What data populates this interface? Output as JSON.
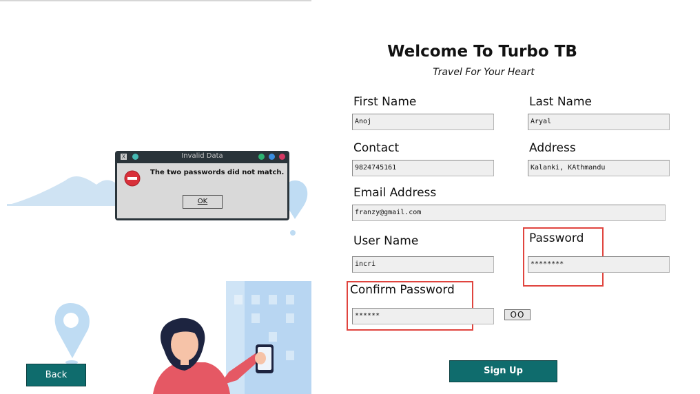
{
  "app": {
    "title": "Welcome To Turbo TB",
    "subtitle": "Travel For Your Heart"
  },
  "form": {
    "first_name": {
      "label": "First Name",
      "value": "Anoj"
    },
    "last_name": {
      "label": "Last Name",
      "value": "Aryal"
    },
    "contact": {
      "label": "Contact",
      "value": "9824745161"
    },
    "address": {
      "label": "Address",
      "value": "Kalanki, KAthmandu"
    },
    "email": {
      "label": "Email Address",
      "value": "franzy@gmail.com"
    },
    "username": {
      "label": "User Name",
      "value": "incri"
    },
    "password": {
      "label": "Password",
      "value": "********"
    },
    "confirm_password": {
      "label": "Confirm Password",
      "value": "******"
    },
    "toggle_label": "OO",
    "signup_label": "Sign Up"
  },
  "nav": {
    "back_label": "Back"
  },
  "dialog": {
    "title": "Invalid Data",
    "close_glyph": "X",
    "message": "The two passwords did not match.",
    "ok_label": "OK",
    "icon": "error-icon"
  },
  "colors": {
    "button_bg": "#0f6c6d",
    "highlight": "#e0443e",
    "dialog_frame": "#2a343a"
  }
}
